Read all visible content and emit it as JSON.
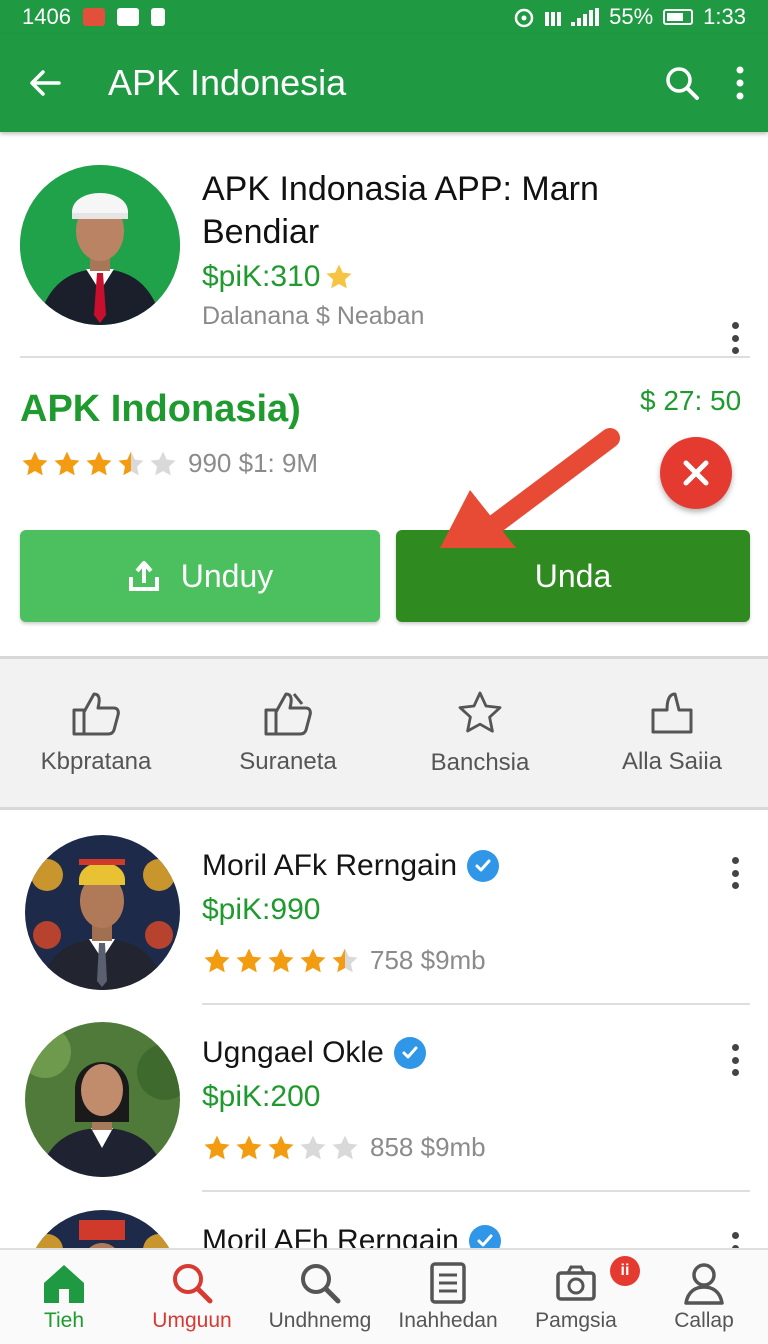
{
  "status_bar": {
    "left_text": "1406",
    "battery": "55%",
    "time": "1:33"
  },
  "app_bar": {
    "title": "APK Indonesia",
    "back_icon": "arrow-left-icon",
    "search_icon": "search-icon",
    "menu_icon": "more-vert-icon",
    "color": "#1f9a42"
  },
  "header_card": {
    "name": "APK Indonasia APP: Marn Bendiar",
    "price": "$piK:310",
    "subtitle": "Dalanana $ Neaban"
  },
  "main_app": {
    "title": "APK Indonasia)",
    "price": "$ 27: 50",
    "rating": 3.5,
    "meta": "990 $1: 9M",
    "download_button": "Unduy",
    "open_button": "Unda",
    "accent_light": "#4cc05f",
    "accent_dark": "#2f8a1f"
  },
  "actions": [
    {
      "label": "Kbpratana",
      "icon": "thumbs-up-icon"
    },
    {
      "label": "Suraneta",
      "icon": "thumbs-up-double-icon"
    },
    {
      "label": "Banchsia",
      "icon": "star-outline-icon"
    },
    {
      "label": "Alla Saiia",
      "icon": "like-box-icon"
    }
  ],
  "list": [
    {
      "name": "Moril AFk Rerngain",
      "price": "$piK:990",
      "rating": 4.5,
      "meta": "758 $9mb",
      "verified": true
    },
    {
      "name": "Ugngael Okle",
      "price": "$piK:200",
      "rating": 3,
      "meta": "858 $9mb",
      "verified": true
    },
    {
      "name": "Moril AFh Rerngain",
      "price": "",
      "rating": 0,
      "meta": "",
      "verified": true
    }
  ],
  "bottom_nav": [
    {
      "label": "Tieh",
      "icon": "home-icon"
    },
    {
      "label": "Umguun",
      "icon": "search-icon"
    },
    {
      "label": "Undhnemg",
      "icon": "search-icon"
    },
    {
      "label": "Inahhedan",
      "icon": "document-icon"
    },
    {
      "label": "Pamgsia",
      "icon": "camera-icon",
      "badge": "ii"
    },
    {
      "label": "Callap",
      "icon": "person-icon"
    }
  ]
}
